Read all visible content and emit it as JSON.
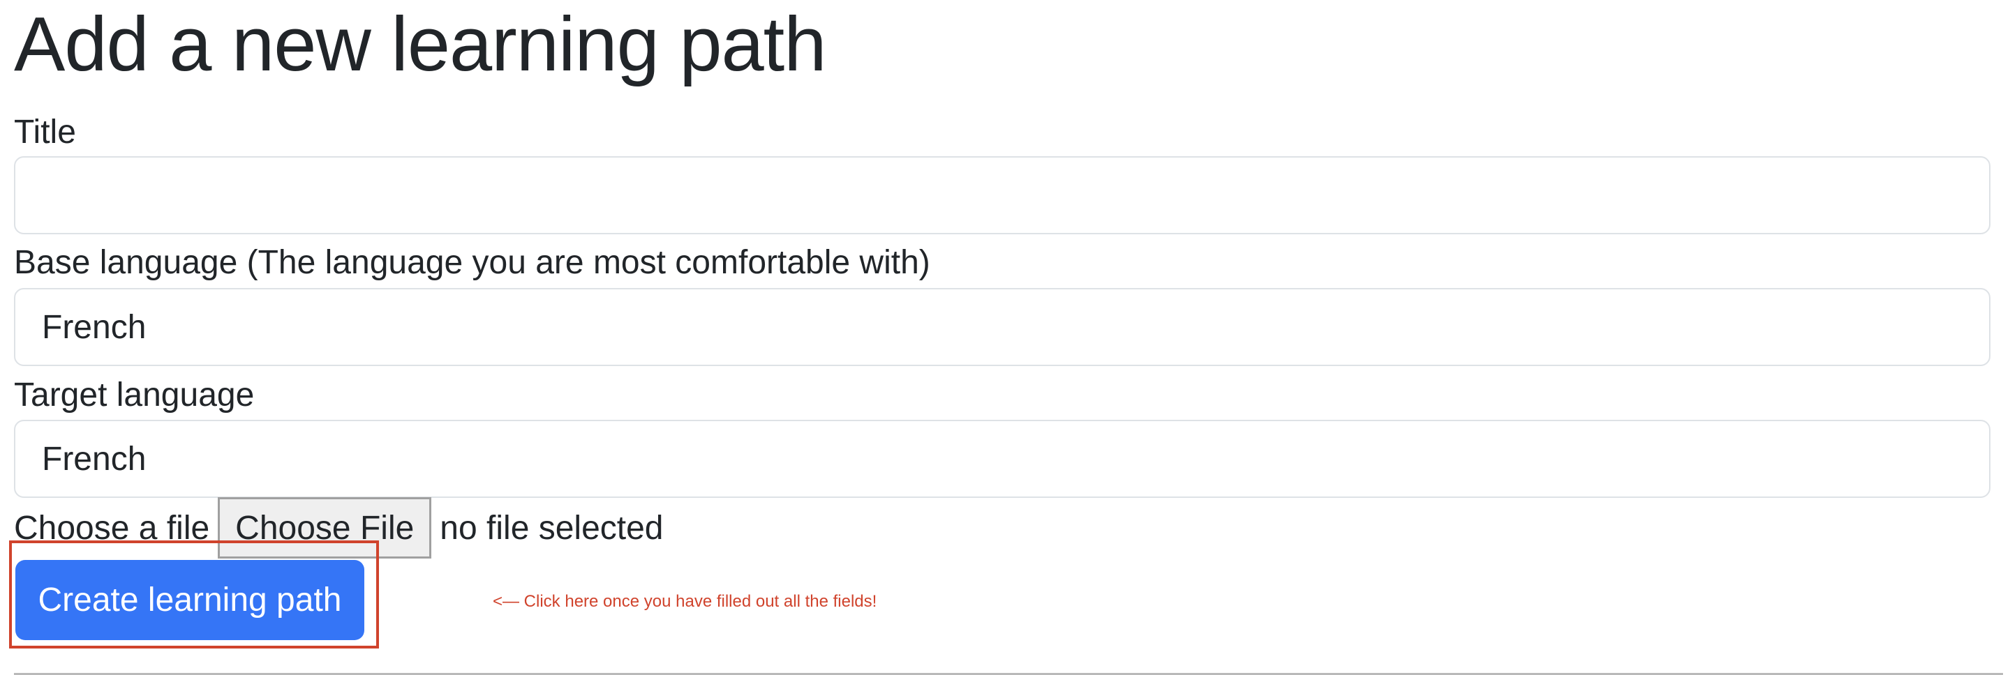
{
  "page": {
    "title": "Add a new learning path"
  },
  "form": {
    "title_field": {
      "label": "Title",
      "value": "",
      "placeholder": ""
    },
    "base_language": {
      "label": "Base language (The language you are most comfortable with)",
      "selected": "French"
    },
    "target_language": {
      "label": "Target language",
      "selected": "French"
    },
    "file_upload": {
      "label": "Choose a file",
      "button_label": "Choose File",
      "status": "no file selected"
    },
    "submit_label": "Create learning path",
    "hint": "<— Click here once you have filled out all the fields!"
  },
  "colors": {
    "primary_button": "#3575f6",
    "annotation_red": "#d0432c",
    "input_border": "#dee2e6",
    "text": "#212529"
  }
}
